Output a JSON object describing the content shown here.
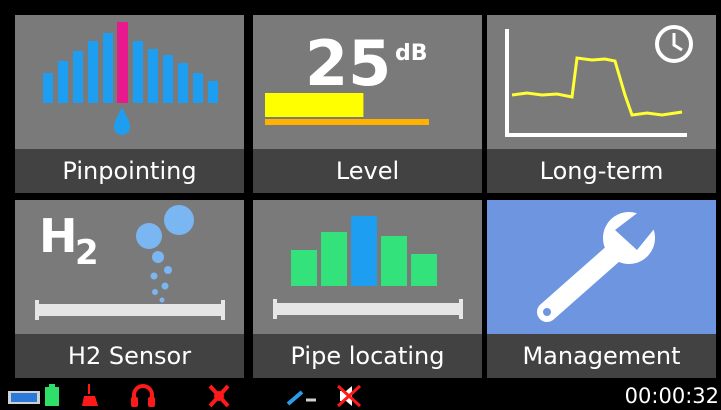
{
  "menu": {
    "tiles": [
      {
        "label": "Pinpointing",
        "icon": "pinpointing-bars-icon"
      },
      {
        "label": "Level",
        "icon": "level-meter-icon",
        "value": "25",
        "unit": "dB",
        "level_fraction": 0.6
      },
      {
        "label": "Long-term",
        "icon": "long-term-chart-clock-icon"
      },
      {
        "label": "H2 Sensor",
        "icon": "h2-bubbles-icon",
        "formula_letter": "H",
        "formula_subscript": "2"
      },
      {
        "label": "Pipe locating",
        "icon": "pipe-locating-bars-icon"
      },
      {
        "label": "Management",
        "icon": "wrench-icon",
        "selected": true
      }
    ]
  },
  "status_bar": {
    "icons": [
      "battery-icon",
      "microphone-icon",
      "headphones-icon",
      "satellite-off-icon",
      "sensor-link-icon",
      "speaker-muted-icon"
    ],
    "time": "00:00:32"
  },
  "colors": {
    "tile_bg": "#7a7a7a",
    "label_bg": "#424242",
    "selected_bg": "#6e95e0",
    "bar_blue": "#1e9ef0",
    "bar_magenta": "#e8198c",
    "level_yellow": "#ffff00",
    "level_orange": "#ffb300",
    "trace_yellow": "#ffff33",
    "pipe_green": "#33e27a",
    "status_red": "#ff1a1a"
  }
}
